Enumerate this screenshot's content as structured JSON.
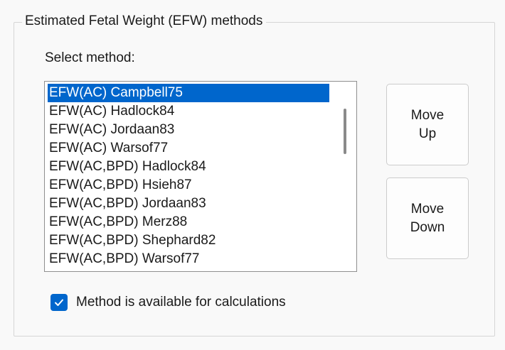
{
  "group": {
    "title": "Estimated Fetal Weight (EFW) methods"
  },
  "select_label": "Select method:",
  "methods": {
    "items": [
      "EFW(AC) Campbell75",
      "EFW(AC) Hadlock84",
      "EFW(AC) Jordaan83",
      "EFW(AC) Warsof77",
      "EFW(AC,BPD) Hadlock84",
      "EFW(AC,BPD) Hsieh87",
      "EFW(AC,BPD) Jordaan83",
      "EFW(AC,BPD) Merz88",
      "EFW(AC,BPD) Shephard82",
      "EFW(AC,BPD) Warsof77"
    ],
    "selected_value": "EFW(AC) Campbell75"
  },
  "buttons": {
    "move_up": "Move Up",
    "move_down": "Move Down"
  },
  "availability": {
    "label": "Method is available for calculations",
    "checked": true
  },
  "colors": {
    "accent": "#0066cc",
    "background": "#f9f9f9"
  }
}
